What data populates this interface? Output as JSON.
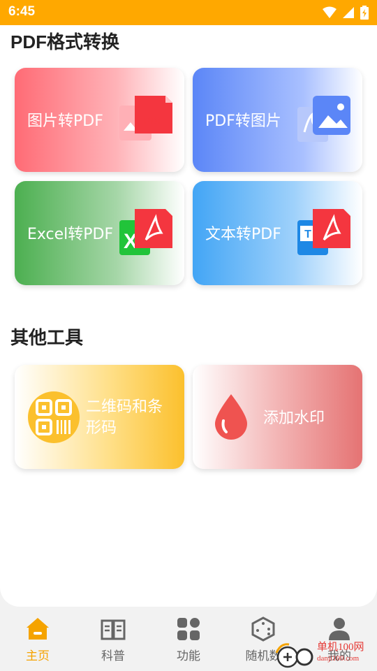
{
  "status_bar": {
    "time": "6:45"
  },
  "sections": {
    "pdf_convert_title": "PDF格式转换",
    "other_tools_title": "其他工具"
  },
  "tiles": {
    "img2pdf": {
      "label": "图片转PDF"
    },
    "pdf2img": {
      "label": "PDF转图片"
    },
    "excel2pdf": {
      "label": "Excel转PDF"
    },
    "text2pdf": {
      "label": "文本转PDF"
    },
    "qrcode": {
      "label": "二维码和条形码"
    },
    "watermark": {
      "label": "添加水印"
    }
  },
  "badges": {
    "pdf": "PDF"
  },
  "bottom_nav": [
    {
      "label": "主页",
      "icon": "home-icon",
      "active": true
    },
    {
      "label": "科普",
      "icon": "book-icon",
      "active": false
    },
    {
      "label": "功能",
      "icon": "grid-icon",
      "active": false
    },
    {
      "label": "随机数",
      "icon": "dice-icon",
      "active": false
    },
    {
      "label": "我的",
      "icon": "user-icon",
      "active": false
    }
  ],
  "site_watermark": {
    "title": "单机100网",
    "url": "danji100.com"
  },
  "colors": {
    "accent": "#ffa800",
    "active_nav": "#f5a300",
    "pdf_red": "#f44336"
  }
}
